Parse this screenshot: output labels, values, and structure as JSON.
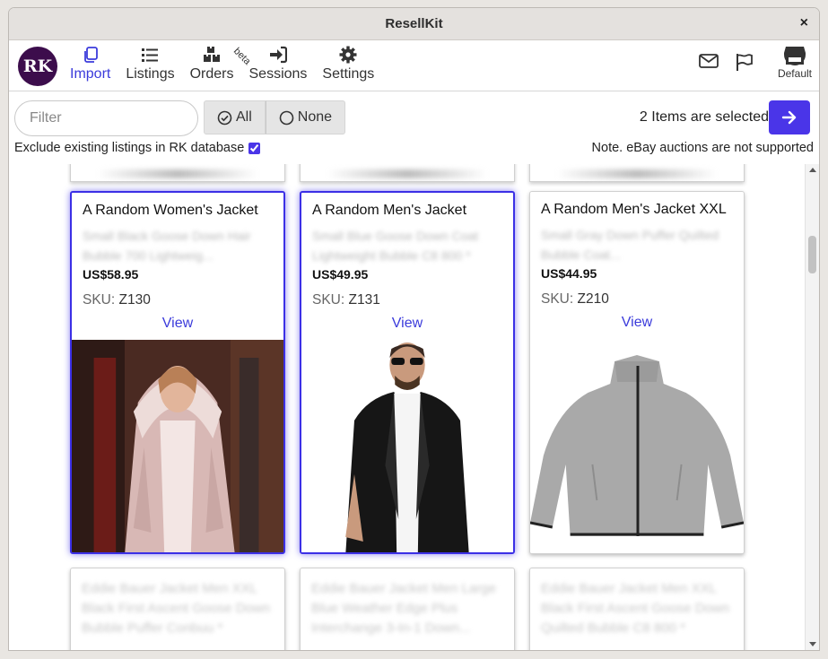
{
  "window": {
    "title": "ResellKit",
    "close_label": "×"
  },
  "logo": {
    "text": "RK",
    "color": "#3c0d4c"
  },
  "nav": {
    "items": [
      {
        "label": "Import",
        "icon": "copy-icon",
        "active": true
      },
      {
        "label": "Listings",
        "icon": "list-icon"
      },
      {
        "label": "Orders",
        "icon": "boxes-icon",
        "badge": "beta"
      },
      {
        "label": "Sessions",
        "icon": "sign-in-icon"
      },
      {
        "label": "Settings",
        "icon": "gear-icon"
      }
    ]
  },
  "right": {
    "mail_icon": "envelope-icon",
    "flag_icon": "flag-icon",
    "store_label": "Default",
    "store_icon": "store-icon"
  },
  "filter": {
    "placeholder": "Filter",
    "value": ""
  },
  "select": {
    "all_label": "All",
    "none_label": "None"
  },
  "status": {
    "selected_text": "2 Items are selected",
    "accent": "#4a35e8"
  },
  "options": {
    "exclude_label": "Exclude existing listings in RK database",
    "exclude_checked": true,
    "note": "Note. eBay auctions are not supported"
  },
  "cards": [
    {
      "title": "A Random Women's Jacket",
      "desc": "Small Black Goose Down Hair Bubble 700 Lightweig...",
      "price": "US$58.95",
      "sku_label": "SKU:",
      "sku": "Z130",
      "view_label": "View",
      "selected": true,
      "image": "woman-fur-parka"
    },
    {
      "title": "A Random Men's Jacket",
      "desc": "Small Blue Goose Down Coat Lightweight Bubble C8 800 *",
      "price": "US$49.95",
      "sku_label": "SKU:",
      "sku": "Z131",
      "view_label": "View",
      "selected": true,
      "image": "man-leather-jacket"
    },
    {
      "title": "A Random Men's Jacket XXL",
      "desc": "Small Gray Down Puffer Quilted Bubble Coat...",
      "price": "US$44.95",
      "sku_label": "SKU:",
      "sku": "Z210",
      "view_label": "View",
      "selected": false,
      "image": "gray-fleece-jacket"
    }
  ],
  "blurred_cards": [
    {
      "text": "Eddie Bauer Jacket Men XXL Black First Ascent Goose Down Bubble Puffer Conbuu *"
    },
    {
      "text": "Eddie Bauer Jacket Men Large Blue Weather Edge Plus Interchange 3-In-1 Down..."
    },
    {
      "text": "Eddie Bauer Jacket Men XXL Black First Ascent Goose Down Quilted Bubble C8 800 *"
    }
  ]
}
